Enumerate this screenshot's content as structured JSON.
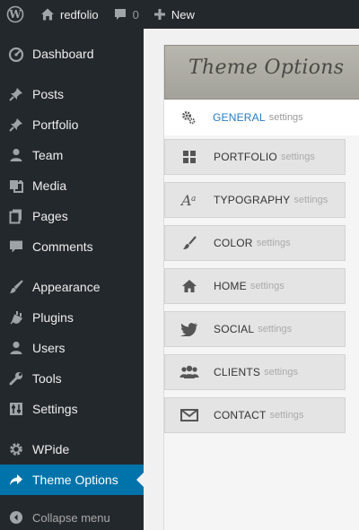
{
  "adminbar": {
    "wp_logo": "wordpress-logo",
    "site_name": "redfolio",
    "comments_count": "0",
    "new_label": "New"
  },
  "sidebar": {
    "items": [
      {
        "label": "Dashboard",
        "icon": "dashboard-icon"
      },
      {
        "label": "Posts",
        "icon": "pin-icon"
      },
      {
        "label": "Portfolio",
        "icon": "pin-icon"
      },
      {
        "label": "Team",
        "icon": "person-icon"
      },
      {
        "label": "Media",
        "icon": "media-icon"
      },
      {
        "label": "Pages",
        "icon": "pages-icon"
      },
      {
        "label": "Comments",
        "icon": "comment-icon"
      },
      {
        "label": "Appearance",
        "icon": "brush-icon"
      },
      {
        "label": "Plugins",
        "icon": "plug-icon"
      },
      {
        "label": "Users",
        "icon": "person-icon"
      },
      {
        "label": "Tools",
        "icon": "wrench-icon"
      },
      {
        "label": "Settings",
        "icon": "sliders-icon"
      },
      {
        "label": "WPide",
        "icon": "gear-icon"
      },
      {
        "label": "Theme Options",
        "icon": "share-arrow-icon"
      }
    ],
    "collapse_label": "Collapse menu"
  },
  "panel": {
    "title": "Theme Options",
    "tabs": [
      {
        "name": "GENERAL",
        "suffix": "settings",
        "icon": "gears-icon"
      },
      {
        "name": "PORTFOLIO",
        "suffix": "settings",
        "icon": "grid-icon"
      },
      {
        "name": "TYPOGRAPHY",
        "suffix": "settings",
        "icon": "font-icon"
      },
      {
        "name": "COLOR",
        "suffix": "settings",
        "icon": "brush-icon"
      },
      {
        "name": "HOME",
        "suffix": "settings",
        "icon": "home-icon"
      },
      {
        "name": "SOCIAL",
        "suffix": "settings",
        "icon": "bird-icon"
      },
      {
        "name": "CLIENTS",
        "suffix": "settings",
        "icon": "people-icon"
      },
      {
        "name": "CONTACT",
        "suffix": "settings",
        "icon": "envelope-icon"
      }
    ]
  },
  "colors": {
    "adminbar_bg": "#23282d",
    "current_item_bg": "#0073aa",
    "active_tab_text": "#2a7bbf"
  }
}
